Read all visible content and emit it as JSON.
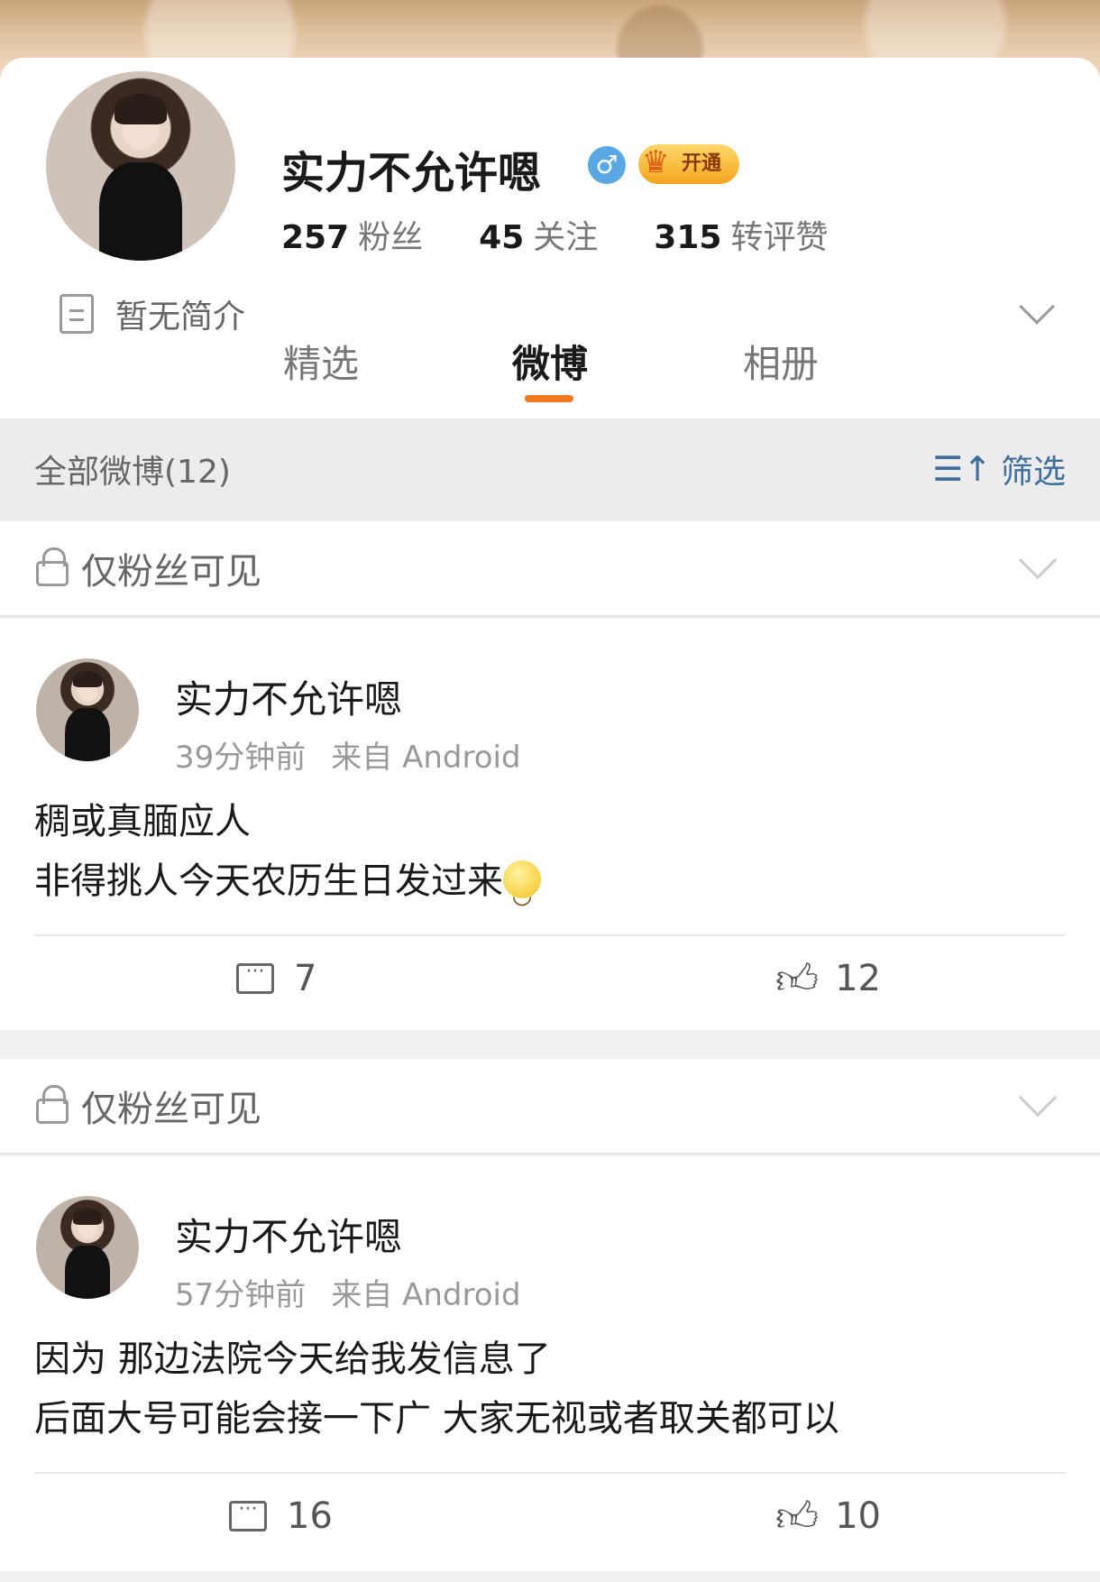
{
  "profile": {
    "username": "实力不允许嗯",
    "gender_icon": "♂",
    "vip_label": "开通",
    "stats": [
      {
        "num": "257",
        "label": "粉丝"
      },
      {
        "num": "45",
        "label": "关注"
      },
      {
        "num": "315",
        "label": "转评赞"
      }
    ],
    "bio": "暂无简介"
  },
  "tabs": [
    "精选",
    "微博",
    "相册"
  ],
  "active_tab": "微博",
  "filter": {
    "title": "全部微博(12)",
    "button_label": "筛选",
    "button_icon": "☰↑"
  },
  "sections": [
    "仅粉丝可见",
    "仅粉丝可见"
  ],
  "posts": [
    {
      "author": "实力不允许嗯",
      "time": "39分钟前",
      "source": "来自 Android",
      "lines": [
        "稠或真腼应人",
        "非得挑人今天农历生日发过来"
      ],
      "comments": "7",
      "likes": "12"
    },
    {
      "author": "实力不允许嗯",
      "time": "57分钟前",
      "source": "来自 Android",
      "lines": [
        "因为  那边法院今天给我发信息了",
        "后面大号可能会接一下广 大家无视或者取关都可以"
      ],
      "comments": "16",
      "likes": "10"
    }
  ],
  "colors": {
    "accent": "#f07a24",
    "link": "#3f6d9c",
    "gender": "#5aa7e6"
  }
}
